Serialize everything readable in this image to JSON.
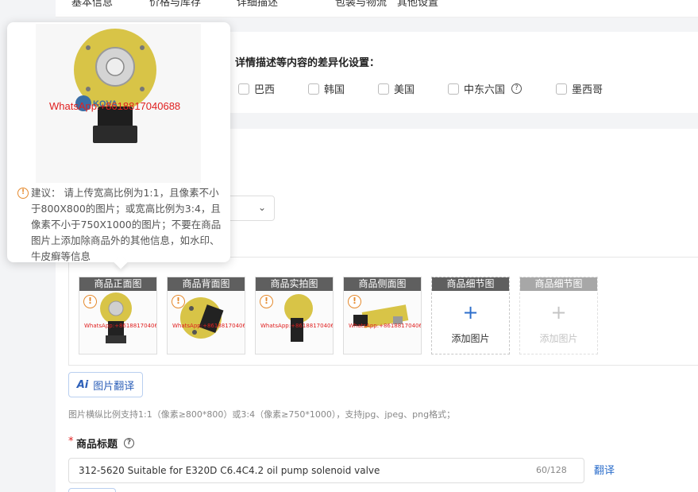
{
  "tabs": [
    "基本信息",
    "价格与库存",
    "详细描述",
    "包装与物流",
    "其他设置"
  ],
  "diff": {
    "title": "详情描述等内容的差异化设置：",
    "countries": [
      {
        "label": "巴西",
        "checked": false
      },
      {
        "label": "韩国",
        "checked": false
      },
      {
        "label": "美国",
        "checked": false
      },
      {
        "label": "中东六国",
        "checked": false,
        "help": "?"
      },
      {
        "label": "墨西哥",
        "checked": false
      }
    ]
  },
  "popover": {
    "watermark": "WhatsApp:+8618817040688",
    "logo_text": "KOVA",
    "icon": "!",
    "tip": "建议： 请上传宽高比例为1:1，且像素不小于800X800的图片；或宽高比例为3:4，且像素不小于750X1000的图片；不要在商品图片上添加除商品外的其他信息，如水印、牛皮癣等信息"
  },
  "select": {
    "chevron": "⌄"
  },
  "images": {
    "slots": [
      {
        "label": "商品正面图",
        "filled": true,
        "watermark": "WhatsApp:+8618817040688",
        "warn": "!"
      },
      {
        "label": "商品背面图",
        "filled": true,
        "watermark": "WhatsApp:+8618817040688",
        "warn": "!"
      },
      {
        "label": "商品实拍图",
        "filled": true,
        "watermark": "WhatsApp:+8618817040688",
        "warn": "!"
      },
      {
        "label": "商品侧面图",
        "filled": true,
        "watermark": "WhatsApp:+8618817040688",
        "warn": "!"
      },
      {
        "label": "商品细节图",
        "filled": false,
        "plus": "+",
        "add": "添加图片"
      },
      {
        "label": "商品细节图",
        "filled": false,
        "plus": "+",
        "add": "添加图片",
        "disabled": true
      }
    ],
    "translate_btn": {
      "icon": "Ai",
      "label": "图片翻译"
    },
    "hint": "图片横纵比例支持1:1（像素≥800*800）或3:4（像素≥750*1000），支持jpg、jpeg、png格式；"
  },
  "product_title": {
    "required_mark": "*",
    "label": "商品标题",
    "help": "?",
    "value": "312-5620 Suitable for E320D C6.4C4.2 oil pump solenoid valve",
    "count": "60/128",
    "translate": "翻译"
  },
  "colors": {
    "accent": "#2c6ecb",
    "warning": "#e58a2e",
    "watermark": "#e02020",
    "part_yellow": "#d8c447"
  }
}
